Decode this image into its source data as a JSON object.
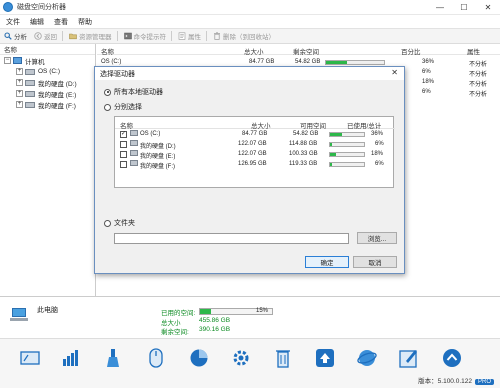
{
  "window": {
    "title": "磁盘空间分析器",
    "controls": {
      "minimize": "—",
      "maximize": "☐",
      "close": "✕"
    }
  },
  "menu": [
    "文件",
    "编辑",
    "查看",
    "帮助"
  ],
  "toolbar": {
    "analyze": "分析",
    "back": "返回",
    "explorer": "资源管理器",
    "cmd": "命令提示符",
    "properties": "属性",
    "delete": "删除（到回收站）"
  },
  "tree": {
    "header": "名称",
    "root": "计算机",
    "drives": [
      "OS (C:)",
      "我的硬盘 (D:)",
      "我的硬盘 (E:)",
      "我的硬盘 (F:)"
    ]
  },
  "list": {
    "headers": {
      "name": "名称",
      "total": "总大小",
      "free": "剩余空间",
      "percent": "百分比",
      "attr": "属性"
    },
    "rows": [
      {
        "name": "OS (C:)",
        "total": "84.77 GB",
        "free": "54.82 GB",
        "percent": "36%",
        "fill": 0.36,
        "attr": "不分析"
      },
      {
        "name": "",
        "total": "",
        "free": "",
        "percent": "6%",
        "fill": 0.06,
        "attr": "不分析"
      },
      {
        "name": "",
        "total": "",
        "free": "",
        "percent": "18%",
        "fill": 0.18,
        "attr": "不分析"
      },
      {
        "name": "",
        "total": "",
        "free": "",
        "percent": "6%",
        "fill": 0.06,
        "attr": "不分析"
      }
    ]
  },
  "dialog": {
    "title": "选择驱动器",
    "close": "✕",
    "opt_all": "所有本地驱动器",
    "opt_each": "分别选择",
    "headers": {
      "name": "名称",
      "total": "总大小",
      "free": "可用空间",
      "used": "已使用/总计"
    },
    "drives": [
      {
        "name": "OS (C:)",
        "total": "84.77 GB",
        "free": "54.82 GB",
        "used": "36%",
        "fill": 0.36,
        "checked": true
      },
      {
        "name": "我的硬盘 (D:)",
        "total": "122.07 GB",
        "free": "114.88 GB",
        "used": "6%",
        "fill": 0.06,
        "checked": false
      },
      {
        "name": "我的硬盘 (E:)",
        "total": "122.07 GB",
        "free": "100.33 GB",
        "used": "18%",
        "fill": 0.18,
        "checked": false
      },
      {
        "name": "我的硬盘 (F:)",
        "total": "126.95 GB",
        "free": "119.33 GB",
        "used": "6%",
        "fill": 0.06,
        "checked": false
      }
    ],
    "opt_folder": "文件夹",
    "folder_value": "",
    "browse": "浏览...",
    "ok": "确定",
    "cancel": "取消",
    "selected_option": "all"
  },
  "status": {
    "title": "此电脑",
    "used_label": "已用的空间:",
    "used_percent": "15%",
    "used_fill": 0.15,
    "total_label": "总大小",
    "total_value": "455.86 GB",
    "free_label": "剩余空间:",
    "free_value": "390.16 GB"
  },
  "bottom": {
    "icons": [
      "disk-icon",
      "grid-chart-icon",
      "cleanup-icon",
      "mouse-icon",
      "pie-chart-icon",
      "settings-icon",
      "delete-icon",
      "upload-icon",
      "ie-icon",
      "edit-icon",
      "up-arrow-icon"
    ],
    "version": "版本：5.100.0.122",
    "badge": "PRO"
  },
  "colors": {
    "accent": "#2db84a",
    "brand": "#1e6fbf",
    "dialog_border": "#6a8fbf"
  }
}
